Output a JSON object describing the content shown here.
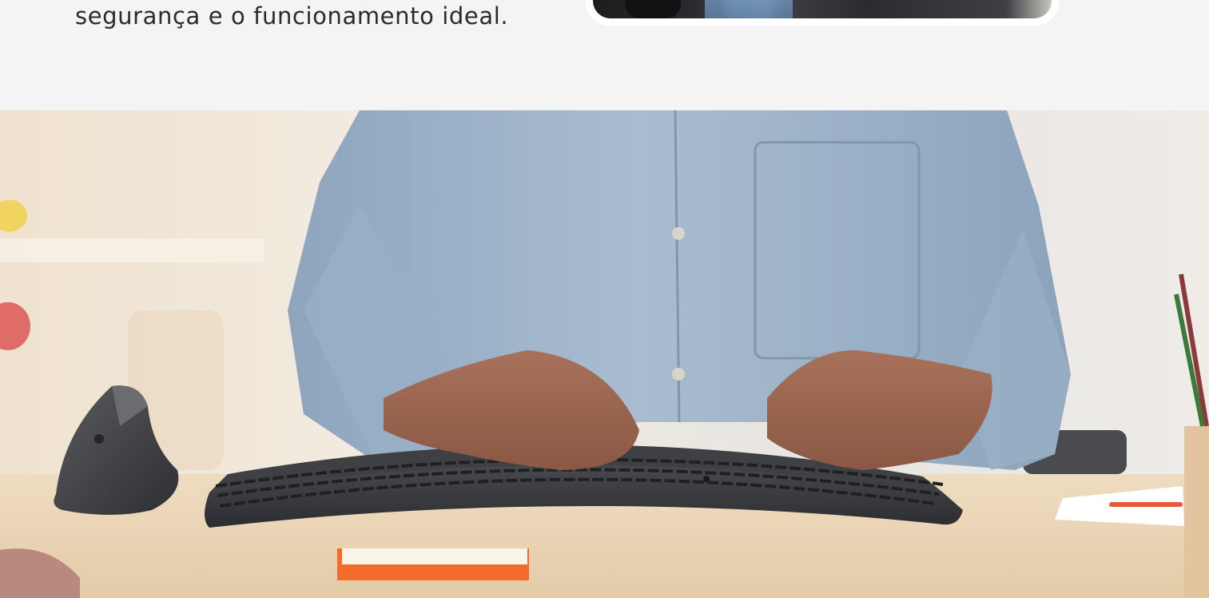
{
  "intro": {
    "text_tail": "segurança e o funcionamento ideal."
  },
  "video": {
    "label": "video thumbnail"
  },
  "hero": {
    "description_icon": "photo-icon"
  },
  "colors": {
    "page_background": "#f4f4f4",
    "text": "#2b2b2b",
    "shirt": "#9fb4c9",
    "desk": "#ead9bf",
    "keyboard": "#3a3b3e",
    "sticky_note": "#f26b2a"
  }
}
